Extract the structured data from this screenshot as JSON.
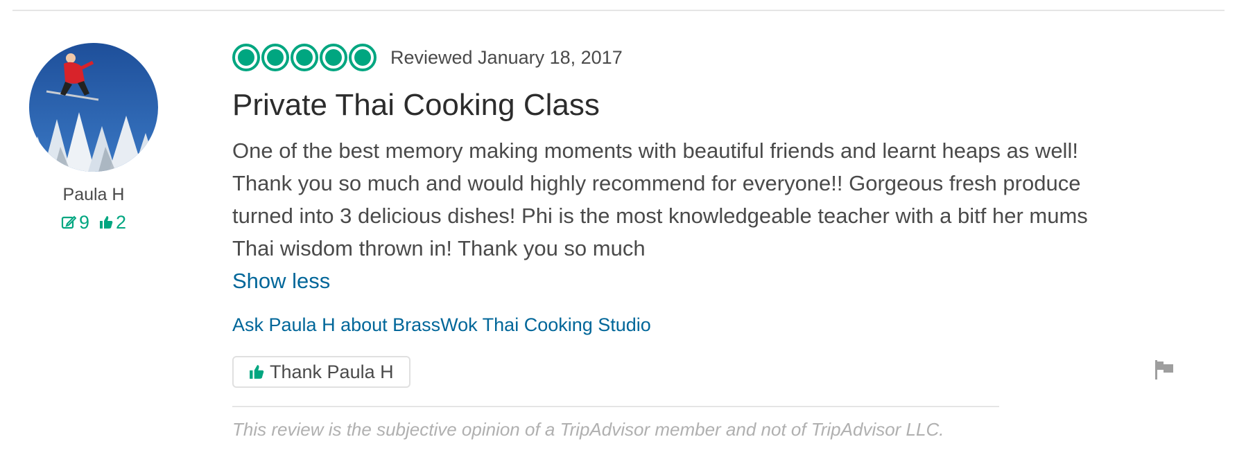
{
  "reviewer": {
    "name": "Paula H",
    "review_count": "9",
    "helpful_votes": "2"
  },
  "review": {
    "rating": 5,
    "rating_max": 5,
    "date": "Reviewed January 18, 2017",
    "title": "Private Thai Cooking Class",
    "text": "One of the best memory making moments with beautiful friends and learnt heaps as well! Thank you so much and would highly recommend for everyone!! Gorgeous fresh produce turned into 3 delicious dishes! Phi is the most knowledgeable teacher with a bitf her mums Thai wisdom thrown in! Thank you so much",
    "show_less_label": "Show less",
    "ask_label": "Ask Paula H about BrassWok Thai Cooking Studio",
    "thank_label": "Thank Paula H",
    "disclaimer": "This review is the subjective opinion of a TripAdvisor member and not of TripAdvisor LLC."
  },
  "colors": {
    "accent": "#00a680",
    "link": "#006699",
    "text": "#4a4a4a"
  },
  "icons": {
    "avatar": "skier-avatar",
    "reviews": "pencil-edit-icon",
    "votes": "thumbs-up-icon",
    "report": "flag-icon"
  }
}
